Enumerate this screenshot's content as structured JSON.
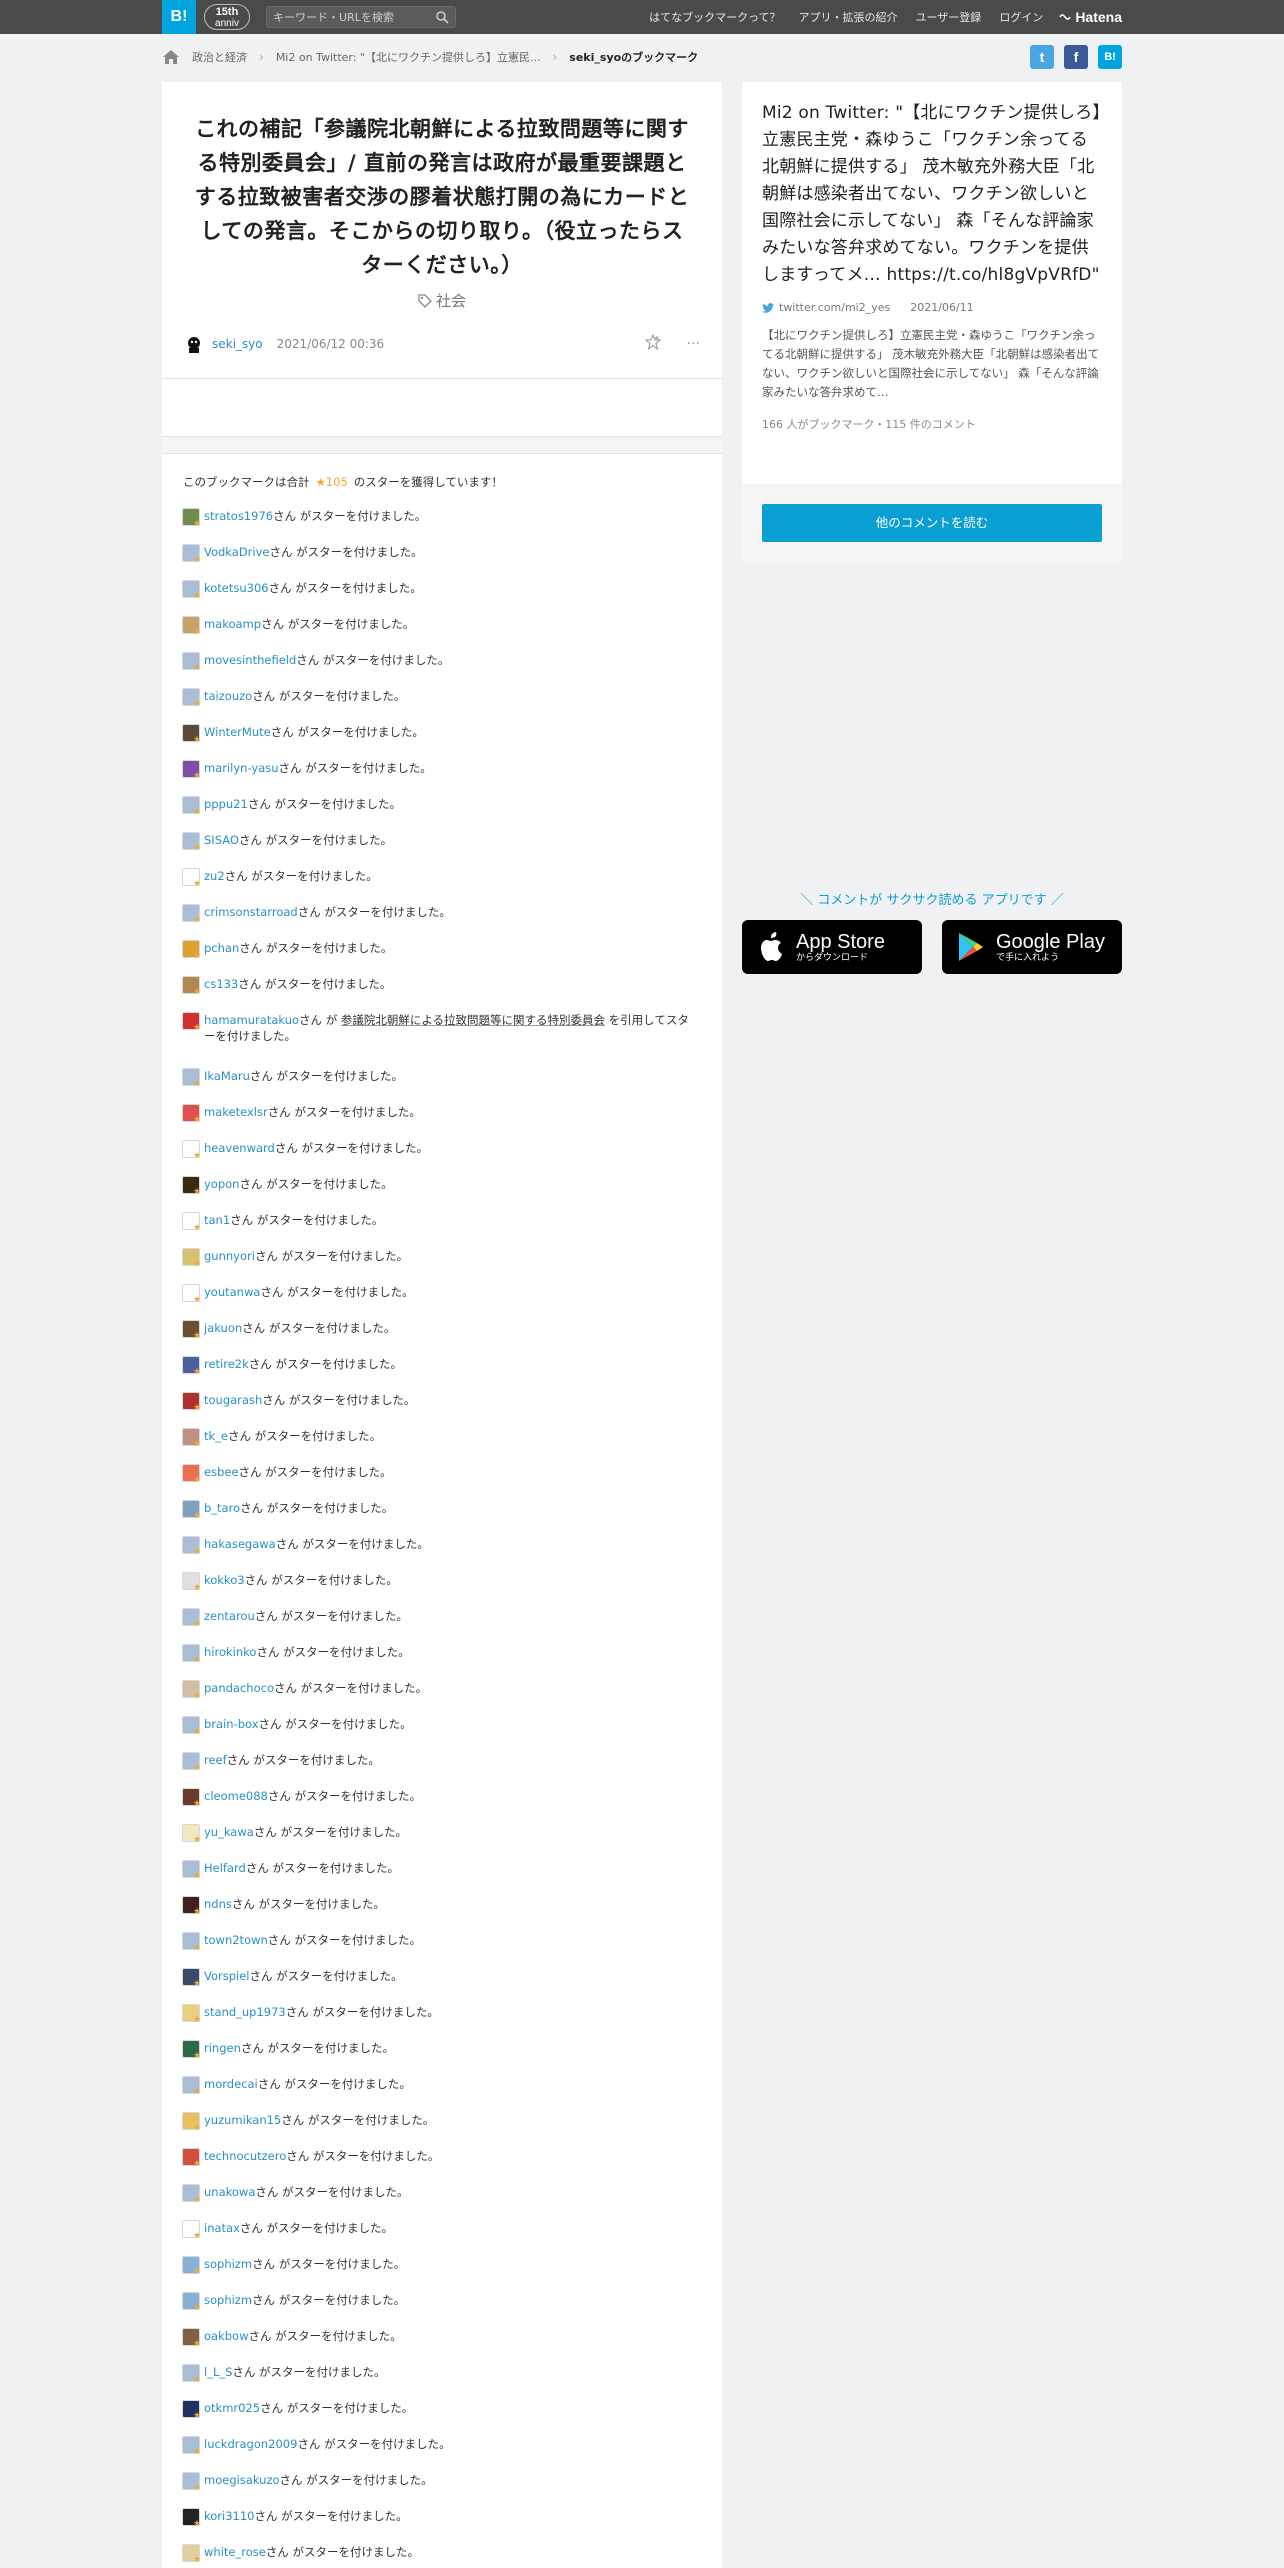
{
  "header": {
    "logo": "B!",
    "anniversary": {
      "top": "15th",
      "bottom": "anniv"
    },
    "search_placeholder": "キーワード・URLを検索",
    "links": [
      "はてなブックマークって？",
      "アプリ・拡張の紹介",
      "ユーザー登録",
      "ログイン"
    ],
    "brand": "Hatena"
  },
  "breadcrumb": {
    "items": [
      "政治と経済",
      "Mi2 on Twitter: \"【北にワクチン提供しろ】立憲民...",
      "seki_syoのブックマーク"
    ]
  },
  "share": {
    "twitter": "t",
    "facebook": "f",
    "hatena": "B!"
  },
  "entry": {
    "title": "これの補記「参議院北朝鮮による拉致問題等に関する特別委員会」/ 直前の発言は政府が最重要課題とする拉致被害者交渉の膠着状態打開の為にカードとしての発言。そこからの切り取り。（役立ったらスターください。）",
    "tag": "社会",
    "user": "seki_syo",
    "date": "2021/06/12 00:36",
    "more": "···"
  },
  "stars": {
    "summary_prefix": "このブックマークは合計",
    "summary_count": "★105",
    "summary_suffix": "のスターを獲得しています！",
    "suffix": "さん がスターを付けました。",
    "quote_user": "hamamuratakuo",
    "quote_mid": "さん が ",
    "quote_text": "参議院北朝鮮による拉致問題等に関する特別委員会",
    "quote_end": " を引用してスターを付けました。",
    "users": [
      {
        "name": "stratos1976",
        "color": "#6b8e4e"
      },
      {
        "name": "VodkaDrive",
        "color": "#a9bfd6"
      },
      {
        "name": "kotetsu306",
        "color": "#a9bfd6"
      },
      {
        "name": "makoamp",
        "color": "#c9a16a"
      },
      {
        "name": "movesinthefield",
        "color": "#a9bfd6"
      },
      {
        "name": "taizouzo",
        "color": "#a9bfd6"
      },
      {
        "name": "WinterMute",
        "color": "#5a4a3a"
      },
      {
        "name": "marilyn-yasu",
        "color": "#7b4fa8"
      },
      {
        "name": "pppu21",
        "color": "#a9bfd6"
      },
      {
        "name": "SISAO",
        "color": "#a9bfd6"
      },
      {
        "name": "zu2",
        "color": "#ffffff"
      },
      {
        "name": "crimsonstarroad",
        "color": "#a9bfd6"
      },
      {
        "name": "pchan",
        "color": "#e0a030"
      },
      {
        "name": "cs133",
        "color": "#b08850"
      },
      {
        "name": "QUOTE",
        "color": "#d03030"
      },
      {
        "name": "IkaMaru",
        "color": "#a9bfd6"
      },
      {
        "name": "maketexlsr",
        "color": "#e05050"
      },
      {
        "name": "heavenward",
        "color": "#ffffff"
      },
      {
        "name": "yopon",
        "color": "#3a2a10"
      },
      {
        "name": "tan1",
        "color": "#ffffff"
      },
      {
        "name": "gunnyori",
        "color": "#d8c070"
      },
      {
        "name": "youtanwa",
        "color": "#ffffff"
      },
      {
        "name": "jakuon",
        "color": "#6a5030"
      },
      {
        "name": "retire2k",
        "color": "#4a60a0"
      },
      {
        "name": "tougarash",
        "color": "#b03030"
      },
      {
        "name": "tk_e",
        "color": "#c09080"
      },
      {
        "name": "esbee",
        "color": "#e87050"
      },
      {
        "name": "b_taro",
        "color": "#80a0c0"
      },
      {
        "name": "hakasegawa",
        "color": "#a9bfd6"
      },
      {
        "name": "kokko3",
        "color": "#e0e0e0"
      },
      {
        "name": "zentarou",
        "color": "#a9bfd6"
      },
      {
        "name": "hirokinko",
        "color": "#a9bfd6"
      },
      {
        "name": "pandachoco",
        "color": "#d0c0a0"
      },
      {
        "name": "brain-box",
        "color": "#a9bfd6"
      },
      {
        "name": "reef",
        "color": "#a9bfd6"
      },
      {
        "name": "cleome088",
        "color": "#6a3a2a"
      },
      {
        "name": "yu_kawa",
        "color": "#f0e8c0"
      },
      {
        "name": "Helfard",
        "color": "#a9bfd6"
      },
      {
        "name": "ndns",
        "color": "#402020"
      },
      {
        "name": "town2town",
        "color": "#a9bfd6"
      },
      {
        "name": "Vorspiel",
        "color": "#3a4a6a"
      },
      {
        "name": "stand_up1973",
        "color": "#e8d080"
      },
      {
        "name": "ringen",
        "color": "#2a6a4a"
      },
      {
        "name": "mordecai",
        "color": "#a9bfd6"
      },
      {
        "name": "yuzumikan15",
        "color": "#e8c060"
      },
      {
        "name": "technocutzero",
        "color": "#d05040"
      },
      {
        "name": "unakowa",
        "color": "#a9bfd6"
      },
      {
        "name": "inatax",
        "color": "#ffffff"
      },
      {
        "name": "sophizm",
        "color": "#8ab0d8"
      },
      {
        "name": "sophizm",
        "color": "#8ab0d8"
      },
      {
        "name": "oakbow",
        "color": "#806040"
      },
      {
        "name": "l_L_S",
        "color": "#a9bfd6"
      },
      {
        "name": "otkmr025",
        "color": "#203060"
      },
      {
        "name": "luckdragon2009",
        "color": "#a9bfd6"
      },
      {
        "name": "moegisakuzo",
        "color": "#a9bfd6"
      },
      {
        "name": "kori3110",
        "color": "#222222"
      },
      {
        "name": "white_rose",
        "color": "#e0d0a0"
      }
    ]
  },
  "sidebar": {
    "title": "Mi2 on Twitter: \"【北にワクチン提供しろ】立憲民主党・森ゆうこ「ワクチン余ってる北朝鮮に提供する」 茂木敏充外務大臣「北朝鮮は感染者出てない、ワクチン欲しいと国際社会に示してない」 森「そんな評論家みたいな答弁求めてない。ワクチンを提供しますってメ… https://t.co/hl8gVpVRfD\"",
    "domain": "twitter.com/mi2_yes",
    "date": "2021/06/11",
    "desc": "【北にワクチン提供しろ】立憲民主党・森ゆうこ「ワクチン余ってる北朝鮮に提供する」 茂木敏充外務大臣「北朝鮮は感染者出てない、ワクチン欲しいと国際社会に示してない」 森「そんな評論家みたいな答弁求めて…",
    "count": "166 人がブックマーク・115 件のコメント",
    "more_button": "他のコメントを読む",
    "app_lead": "＼ コメントが サクサク読める アプリです ／",
    "appstore": {
      "big": "App Store",
      "small": "からダウンロード"
    },
    "googleplay": {
      "big": "Google Play",
      "small": "で手に入れよう"
    }
  },
  "colors": {
    "accent": "#00a4de",
    "star": "#f0a93a",
    "link": "#2a8fc7",
    "button": "#0a9fd3"
  }
}
